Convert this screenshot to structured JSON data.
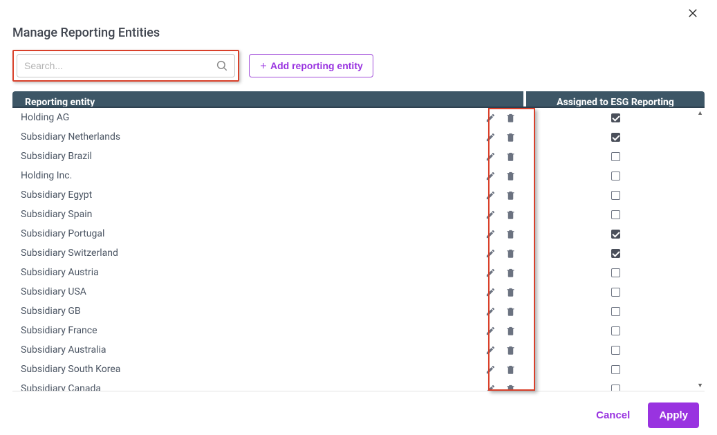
{
  "modal": {
    "title": "Manage Reporting Entities"
  },
  "search": {
    "placeholder": "Search...",
    "value": ""
  },
  "addButton": {
    "label": "Add reporting entity"
  },
  "columns": {
    "entity": "Reporting entity",
    "assigned": "Assigned to ESG Reporting"
  },
  "rows": [
    {
      "name": "Holding AG",
      "assigned": true
    },
    {
      "name": "Subsidiary Netherlands",
      "assigned": true
    },
    {
      "name": "Subsidiary Brazil",
      "assigned": false
    },
    {
      "name": "Holding Inc.",
      "assigned": false
    },
    {
      "name": "Subsidiary Egypt",
      "assigned": false
    },
    {
      "name": "Subsidiary Spain",
      "assigned": false
    },
    {
      "name": "Subsidiary Portugal",
      "assigned": true
    },
    {
      "name": "Subsidiary Switzerland",
      "assigned": true
    },
    {
      "name": "Subsidiary Austria",
      "assigned": false
    },
    {
      "name": "Subsidiary USA",
      "assigned": false
    },
    {
      "name": "Subsidiary GB",
      "assigned": false
    },
    {
      "name": "Subsidiary France",
      "assigned": false
    },
    {
      "name": "Subsidiary Australia",
      "assigned": false
    },
    {
      "name": "Subsidiary South Korea",
      "assigned": false
    },
    {
      "name": "Subsidiary Canada",
      "assigned": false
    }
  ],
  "footer": {
    "cancel": "Cancel",
    "apply": "Apply"
  }
}
